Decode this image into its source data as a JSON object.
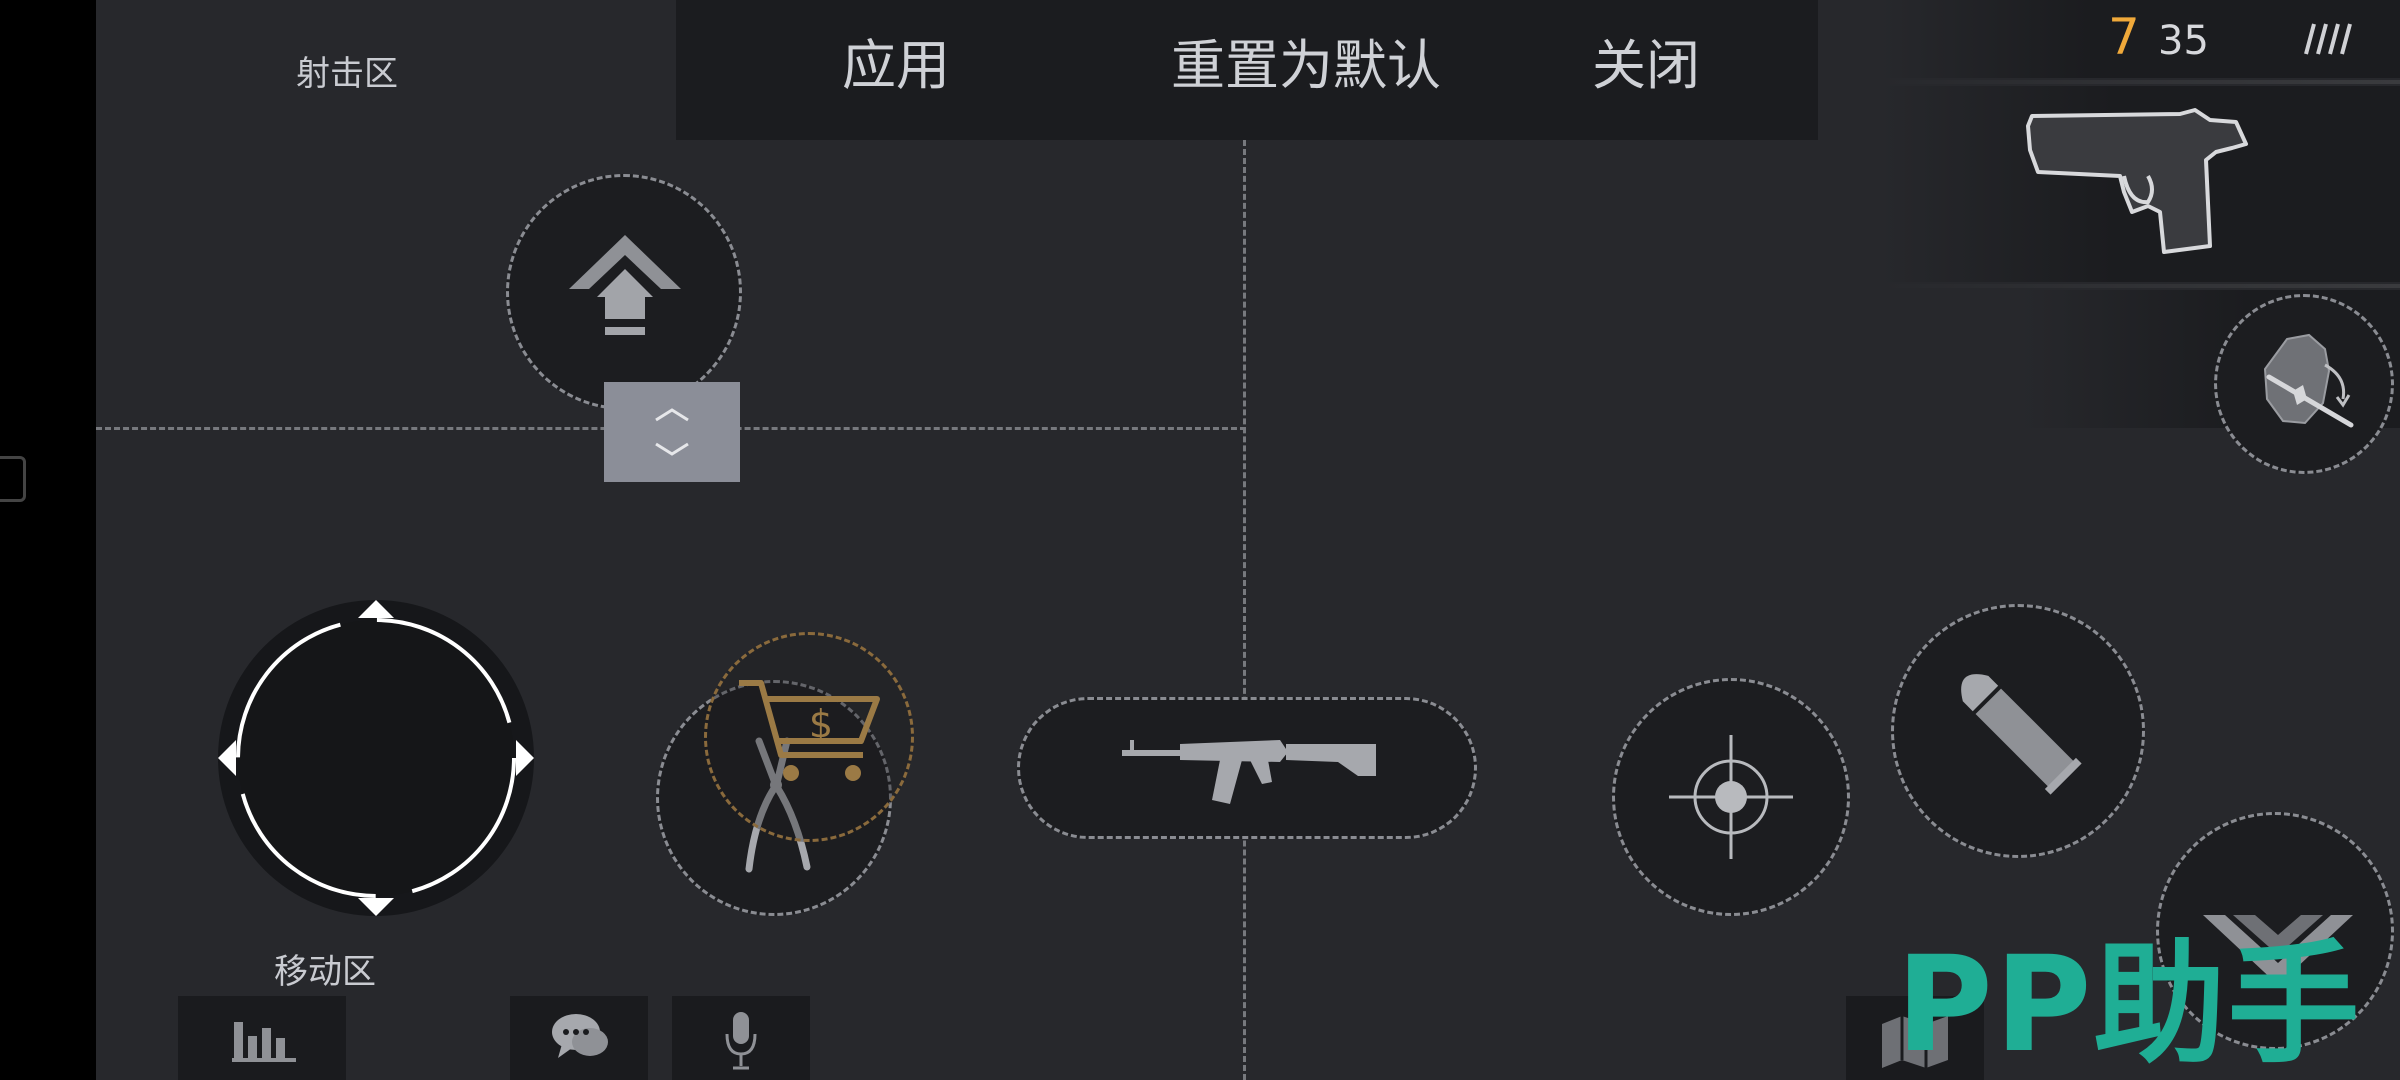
{
  "labels": {
    "shoot_zone": "射击区",
    "move_zone": "移动区"
  },
  "top_menu": {
    "apply": "应用",
    "reset": "重置为默认",
    "close": "关闭"
  },
  "hud": {
    "ammo_clip": "7",
    "ammo_reserve": "35"
  },
  "watermark": "PP助手",
  "colors": {
    "background": "#27282c",
    "menu_bar": "#1b1c1f",
    "ammo_clip": "#f0a93a",
    "button_fill": "#1c1d20",
    "dashed": "#8a8c92",
    "shop_ring": "#8a6a3c",
    "watermark": "#1fae95",
    "icon": "#8f9196"
  },
  "icons": {
    "jump": "jump-arrow-icon",
    "adjust": "up-down-chevron-icon",
    "joystick": "joystick-icon",
    "defuse": "pliers-icon",
    "shop": "shopping-cart-icon",
    "primary_weapon": "assault-rifle-icon",
    "aim": "crosshair-icon",
    "reload": "bullet-icon",
    "crouch": "double-chevron-down-icon",
    "pistol": "pistol-icon",
    "grenade_switch": "grenade-rifle-switch-icon",
    "ammo_bars": "magazine-icon",
    "scoreboard": "bar-chart-icon",
    "chat": "chat-bubble-icon",
    "voice": "microphone-icon",
    "map": "map-icon"
  }
}
